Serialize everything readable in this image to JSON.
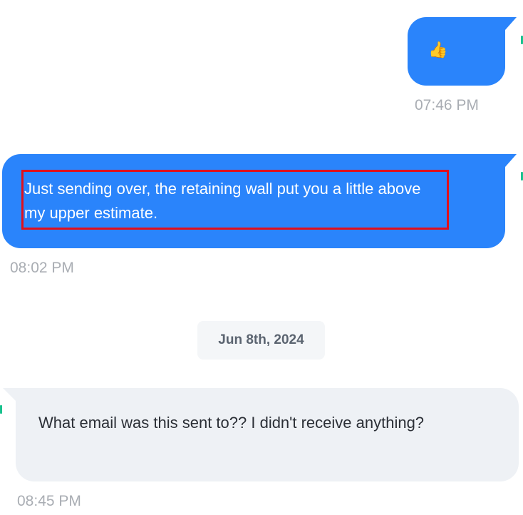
{
  "messages": [
    {
      "direction": "outgoing",
      "content": "👍",
      "time": "07:46 PM"
    },
    {
      "direction": "outgoing",
      "content": "Just sending over, the retaining wall put you a little above my upper estimate.",
      "time": "08:02 PM",
      "highlighted": true
    },
    {
      "direction": "incoming",
      "content": "What email was this sent to?? I didn't receive anything?",
      "time": "08:45 PM"
    }
  ],
  "date_separator": "Jun 8th, 2024",
  "colors": {
    "outgoing_bubble": "#2a84fb",
    "incoming_bubble": "#eef1f5",
    "highlight_border": "#e0101c",
    "timestamp": "#a9adb3",
    "read_receipt": "#19c28e"
  }
}
